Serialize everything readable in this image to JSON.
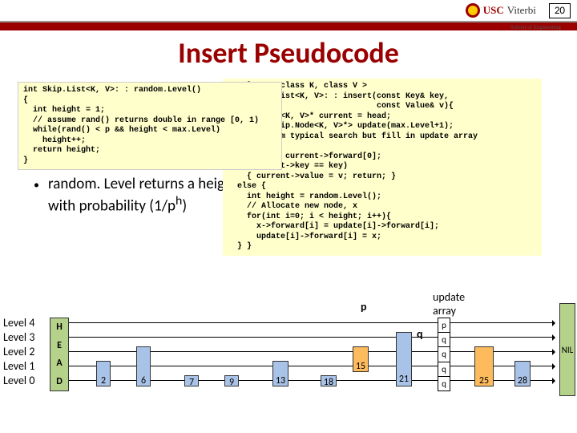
{
  "page_number": "20",
  "branding": {
    "usc": "USC",
    "viterbi": "Viterbi",
    "school": "School of Engineering"
  },
  "title": "Insert Pseudocode",
  "code_left": "int Skip.List<K, V>: : random.Level()\n{\n  int height = 1;\n  // assume rand() returns double in range [0, 1)\n  while(rand() < p && height < max.Level)\n    height++;\n  return height;\n}",
  "code_right": "template < class K, class V >\nvoid Skip.List<K, V>: : insert(const Key& key,\n                               const Value& v){\n  Skip.Node<K, V>* current = head;\n  vector<Skip.Node<K, V>*> update(max.Level+1);\n  // perform typical search but fill in update array\n  // ...\n  current = current->forward[0];\n  if(current->key == key)\n    { current->value = v; return; }\n  else {\n    int height = random.Level();\n    // Allocate new node, x\n    for(int i=0; i < height; i++){\n      x->forward[i] = update[i]->forward[i];\n      update[i]->forward[i] = x;\n  } }",
  "bullet": {
    "text_pre": "random. Level returns a height >h with probability (1/p",
    "sup": "h",
    "text_post": ")"
  },
  "labels": {
    "p": "p",
    "q": "q",
    "update_array": "update\narray",
    "nil": "NIL",
    "levels": [
      "Level 4",
      "Level 3",
      "Level 2",
      "Level 1",
      "Level 0"
    ],
    "head_letters": [
      "H",
      "E",
      "A",
      "D"
    ]
  },
  "nodes": {
    "n2": "2",
    "n6": "6",
    "n7": "7",
    "n9": "9",
    "n13": "13",
    "n15": "15",
    "n18": "18",
    "n21": "21",
    "n25": "25",
    "n28": "28"
  },
  "update_cells": [
    "p",
    "q",
    "q",
    "q",
    "q"
  ]
}
